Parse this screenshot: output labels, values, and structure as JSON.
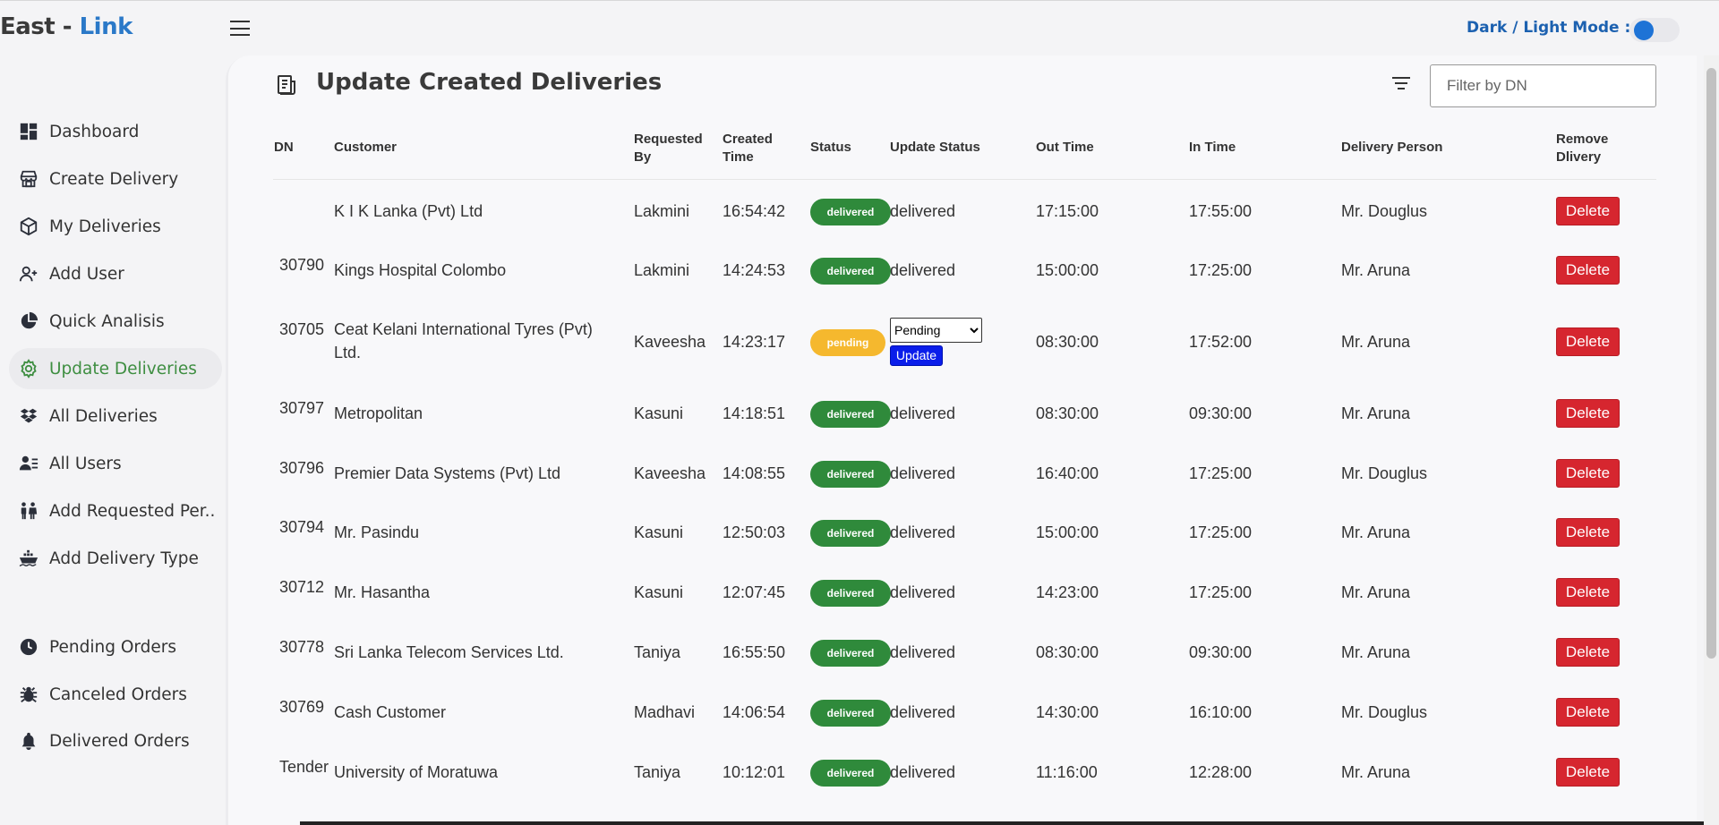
{
  "app": {
    "logo_part1": "East - ",
    "logo_part2": "Link",
    "mode_label": "Dark / Light Mode :"
  },
  "sidebar": {
    "items": [
      {
        "label": "Dashboard",
        "icon": "dashboard-icon"
      },
      {
        "label": "Create Delivery",
        "icon": "store-icon"
      },
      {
        "label": "My Deliveries",
        "icon": "package-icon"
      },
      {
        "label": "Add User",
        "icon": "user-plus-icon"
      },
      {
        "label": "Quick Analisis",
        "icon": "pie-chart-icon"
      },
      {
        "label": "Update Deliveries",
        "icon": "gear-icon",
        "active": true
      },
      {
        "label": "All Deliveries",
        "icon": "dropbox-icon"
      },
      {
        "label": "All Users",
        "icon": "users-list-icon"
      },
      {
        "label": "Add Requested Per..",
        "icon": "people-icon"
      },
      {
        "label": "Add Delivery Type",
        "icon": "ship-icon"
      }
    ],
    "orders": [
      {
        "label": "Pending Orders",
        "icon": "clock-icon"
      },
      {
        "label": "Canceled Orders",
        "icon": "bug-icon"
      },
      {
        "label": "Delivered Orders",
        "icon": "bell-icon"
      }
    ]
  },
  "page": {
    "title": "Update Created Deliveries",
    "filter_placeholder": "Filter by DN"
  },
  "table": {
    "headers": {
      "dn": "DN",
      "customer": "Customer",
      "requested_by_1": "Requested",
      "requested_by_2": "By",
      "created_time_1": "Created",
      "created_time_2": "Time",
      "status": "Status",
      "update_status": "Update Status",
      "out_time": "Out Time",
      "in_time": "In Time",
      "delivery_person": "Delivery Person",
      "remove_1": "Remove",
      "remove_2": "Dlivery"
    },
    "delete_label": "Delete",
    "update_label": "Update",
    "rows": [
      {
        "dn": "",
        "customer": "K I K Lanka (Pvt) Ltd",
        "customer2": "",
        "requested_by": "Lakmini",
        "created": "16:54:42",
        "status": "delivered",
        "update_status": "delivered",
        "out": "17:15:00",
        "in": "17:55:00",
        "person": "Mr. Douglus"
      },
      {
        "dn": "30790",
        "customer": "Kings Hospital Colombo",
        "customer2": "",
        "requested_by": "Lakmini",
        "created": "14:24:53",
        "status": "delivered",
        "update_status": "delivered",
        "out": "15:00:00",
        "in": "17:25:00",
        "person": "Mr. Aruna"
      },
      {
        "dn": "30705",
        "customer": "Ceat Kelani International Tyres (Pvt)",
        "customer2": "Ltd.",
        "requested_by": "Kaveesha",
        "created": "14:23:17",
        "status": "pending",
        "update_status": "Pending",
        "out": "08:30:00",
        "in": "17:52:00",
        "person": "Mr. Aruna"
      },
      {
        "dn": "30797",
        "customer": "Metropolitan",
        "customer2": "",
        "requested_by": "Kasuni",
        "created": "14:18:51",
        "status": "delivered",
        "update_status": "delivered",
        "out": "08:30:00",
        "in": "09:30:00",
        "person": "Mr. Aruna"
      },
      {
        "dn": "30796",
        "customer": "Premier Data Systems (Pvt) Ltd",
        "customer2": "",
        "requested_by": "Kaveesha",
        "created": "14:08:55",
        "status": "delivered",
        "update_status": "delivered",
        "out": "16:40:00",
        "in": "17:25:00",
        "person": "Mr. Douglus"
      },
      {
        "dn": "30794",
        "customer": "Mr. Pasindu",
        "customer2": "",
        "requested_by": "Kasuni",
        "created": "12:50:03",
        "status": "delivered",
        "update_status": "delivered",
        "out": "15:00:00",
        "in": "17:25:00",
        "person": "Mr. Aruna"
      },
      {
        "dn": "30712",
        "customer": "Mr. Hasantha",
        "customer2": "",
        "requested_by": "Kasuni",
        "created": "12:07:45",
        "status": "delivered",
        "update_status": "delivered",
        "out": "14:23:00",
        "in": "17:25:00",
        "person": "Mr. Aruna"
      },
      {
        "dn": "30778",
        "customer": "Sri Lanka Telecom Services Ltd.",
        "customer2": "",
        "requested_by": "Taniya",
        "created": "16:55:50",
        "status": "delivered",
        "update_status": "delivered",
        "out": "08:30:00",
        "in": "09:30:00",
        "person": "Mr. Aruna"
      },
      {
        "dn": "30769",
        "customer": "Cash Customer",
        "customer2": "",
        "requested_by": "Madhavi",
        "created": "14:06:54",
        "status": "delivered",
        "update_status": "delivered",
        "out": "14:30:00",
        "in": "16:10:00",
        "person": "Mr. Douglus"
      },
      {
        "dn": "Tender",
        "customer": "University of Moratuwa",
        "customer2": "",
        "requested_by": "Taniya",
        "created": "10:12:01",
        "status": "delivered",
        "update_status": "delivered",
        "out": "11:16:00",
        "in": "12:28:00",
        "person": "Mr. Aruna"
      }
    ]
  }
}
